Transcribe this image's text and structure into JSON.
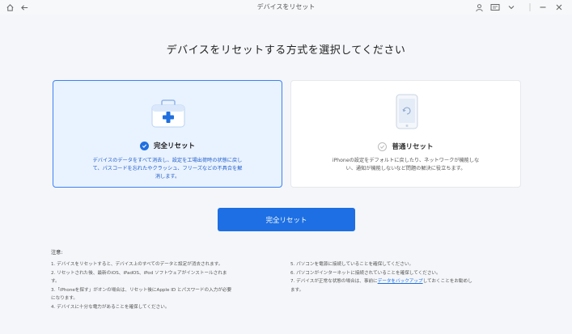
{
  "window": {
    "title": "デバイスをリセット"
  },
  "main": {
    "heading": "デバイスをリセットする方式を選択してください"
  },
  "options": [
    {
      "title": "完全リセット",
      "desc_lines": [
        "デバイスのデータをすべて消去し、設定を工場出荷時の状態に戻し",
        "て、パスコードを忘れたやクラッシュ、フリーズなどの不具合を解",
        "消します。"
      ],
      "selected": true
    },
    {
      "title": "普通リセット",
      "desc_lines": [
        "iPhoneの設定をデフォルトに戻したり、ネットワークが機能しな",
        "い、通知が機能しないなど問題の解決に役立ちます。"
      ],
      "selected": false
    }
  ],
  "action": {
    "button_label": "完全リセット"
  },
  "notes": {
    "title": "注意:",
    "left": [
      "1. デバイスをリセットすると、デバイス上のすべてのデータと設定が消去されます。",
      "2. リセットされた後、最新のiOS、iPadOS、iPod ソフトウェアがインストールされま",
      "す。",
      "3.「iPhoneを探す」がオンの場合は、リセット後にApple ID とパスワードの入力が必要",
      "になります。",
      "4. デバイスに十分な電力があることを確保してください。"
    ],
    "right": [
      "5. パソコンを電源に接続していることを確保してください。",
      "6. パソコンがインターネットに接続されていることを確保してください。"
    ],
    "right_7_prefix": "7. デバイスが正常な状態の場合は、事前に",
    "right_7_link": "データをバックアップ",
    "right_7_suffix": "しておくことをお勧めし",
    "right_7_cont": "ます。"
  },
  "colors": {
    "accent": "#1d6fe3",
    "selected_bg": "#e9f2ff",
    "selected_border": "#3b82f6",
    "background": "#f4f6f9"
  },
  "icons": [
    "home-icon",
    "back-arrow-icon",
    "user-icon",
    "feedback-icon",
    "chevron-down-icon",
    "minimize-icon",
    "close-icon",
    "medkit-icon",
    "phone-reset-icon",
    "check-icon"
  ]
}
